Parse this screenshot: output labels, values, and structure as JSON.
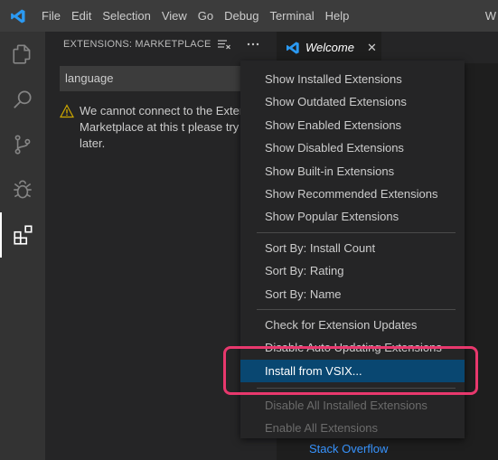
{
  "menubar": {
    "items": [
      "File",
      "Edit",
      "Selection",
      "View",
      "Go",
      "Debug",
      "Terminal",
      "Help"
    ],
    "overflow": "W"
  },
  "sidebar": {
    "title": "EXTENSIONS: MARKETPLACE",
    "search_value": "language",
    "warning": "We cannot connect to the Extensions Marketplace at this t please try again later."
  },
  "editor": {
    "tab_label": "Welcome",
    "link_stack_overflow": "Stack Overflow"
  },
  "context_menu": {
    "group1": [
      "Show Installed Extensions",
      "Show Outdated Extensions",
      "Show Enabled Extensions",
      "Show Disabled Extensions",
      "Show Built-in Extensions",
      "Show Recommended Extensions",
      "Show Popular Extensions"
    ],
    "group2": [
      "Sort By: Install Count",
      "Sort By: Rating",
      "Sort By: Name"
    ],
    "group3": [
      "Check for Extension Updates",
      "Disable Auto Updating Extensions",
      "Install from VSIX...",
      "Disable All Installed Extensions",
      "Enable All Extensions"
    ]
  },
  "colors": {
    "accent_highlight": "#094771",
    "annotation": "#e8386d",
    "link": "#3794ff",
    "warning": "#cca700"
  },
  "icons": [
    "vscode-logo-icon",
    "explorer-icon",
    "search-icon",
    "source-control-icon",
    "debug-icon",
    "extensions-icon",
    "clear-filter-icon",
    "more-actions-icon",
    "warning-icon",
    "close-icon"
  ]
}
